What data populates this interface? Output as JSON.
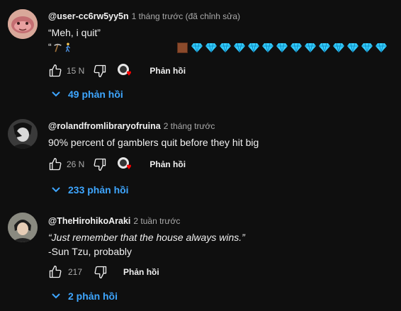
{
  "comments": [
    {
      "author": "@user-cc6rw5yy5n",
      "time": "1 tháng trước (đã chỉnh sửa)",
      "line1": "“Meh, i quit”",
      "line2_prefix": "“",
      "gem_count": 14,
      "likes": "15 N",
      "reply_label": "Phản hồi",
      "replies": "49 phản hồi",
      "avatar": "pink-blob-avatar"
    },
    {
      "author": "@rolandfromlibraryofruina",
      "time": "2 tháng trước",
      "line1": "90% percent of gamblers quit before they hit big",
      "likes": "26 N",
      "reply_label": "Phản hồi",
      "replies": "233 phản hồi",
      "avatar": "dark-figure-avatar"
    },
    {
      "author": "@TheHirohikoAraki",
      "time": "2 tuần trước",
      "line1": "“Just remember that the house always wins.”",
      "line2": "-Sun Tzu, probably",
      "likes": "217",
      "reply_label": "Phản hồi",
      "replies": "2 phản hồi",
      "avatar": "portrait-avatar"
    }
  ],
  "colors": {
    "background": "#0f0f0f",
    "link": "#3ea6ff",
    "heart": "#ff0000",
    "gem": "#33ccff"
  }
}
